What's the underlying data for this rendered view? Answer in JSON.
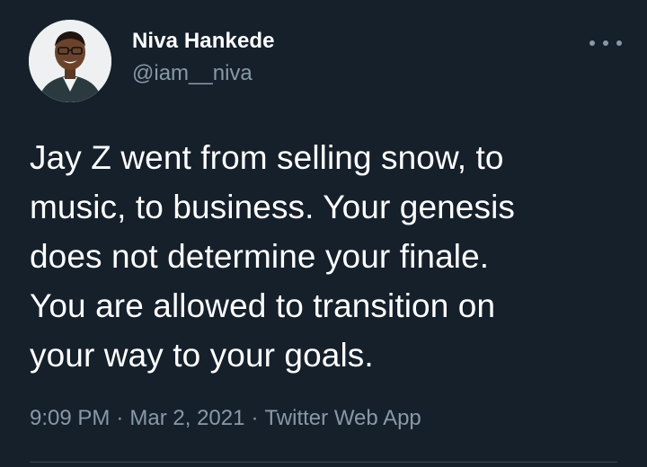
{
  "author": {
    "display_name": "Niva Hankede",
    "handle": "@iam__niva",
    "avatar_icon": "profile-photo"
  },
  "more_icon": "more-horizontal-icon",
  "tweet": {
    "lines": [
      "Jay Z went from selling snow, to",
      "music, to business. Your genesis",
      "does not determine your finale.",
      "You are allowed to transition on",
      "your way to your goals."
    ]
  },
  "meta": {
    "time": "9:09 PM",
    "separator": "·",
    "date": "Mar 2, 2021",
    "source": "Twitter Web App"
  },
  "colors": {
    "background": "#15202b",
    "text": "#ffffff",
    "secondary": "#8899a6",
    "divider": "#38444d"
  }
}
